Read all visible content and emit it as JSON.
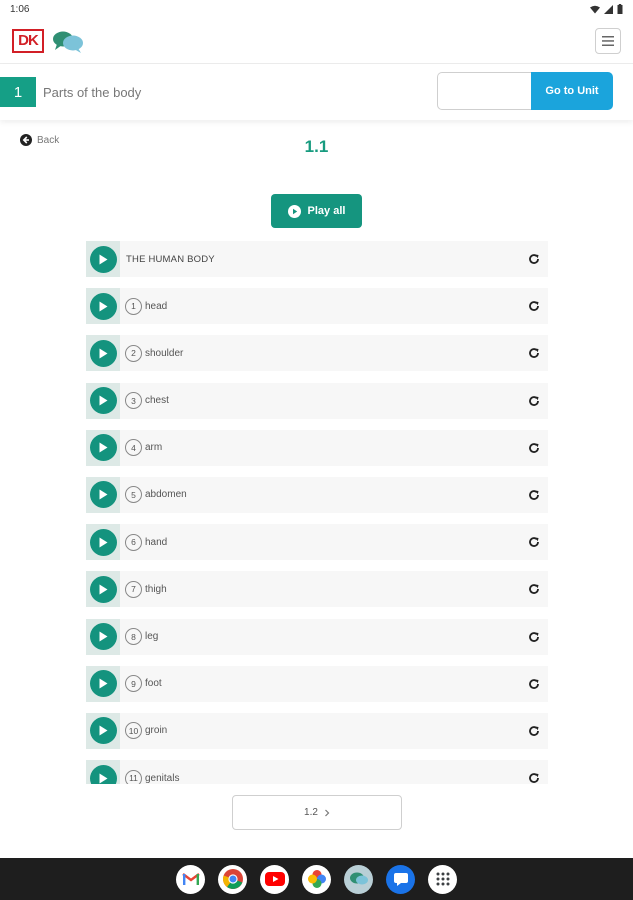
{
  "status_bar": {
    "time": "1:06"
  },
  "header": {
    "brand": "DK",
    "menu_icon": "hamburger-icon"
  },
  "unit_bar": {
    "unit_number": "1",
    "unit_title": "Parts of the body",
    "unit_input_value": "",
    "goto_label": "Go to Unit"
  },
  "nav": {
    "back_label": "Back"
  },
  "section": {
    "title": "1.1"
  },
  "play_all_label": "Play all",
  "tracks": {
    "heading": "THE HUMAN BODY",
    "items": [
      {
        "num": "1",
        "label": "head"
      },
      {
        "num": "2",
        "label": "shoulder"
      },
      {
        "num": "3",
        "label": "chest"
      },
      {
        "num": "4",
        "label": "arm"
      },
      {
        "num": "5",
        "label": "abdomen"
      },
      {
        "num": "6",
        "label": "hand"
      },
      {
        "num": "7",
        "label": "thigh"
      },
      {
        "num": "8",
        "label": "leg"
      },
      {
        "num": "9",
        "label": "foot"
      },
      {
        "num": "10",
        "label": "groin"
      },
      {
        "num": "11",
        "label": "genitals"
      }
    ]
  },
  "pagination": {
    "next_label": "1.2"
  },
  "colors": {
    "accent_green": "#159f86",
    "accent_blue": "#1ba4dc",
    "brand_red": "#d21f26"
  },
  "dock_icons": [
    "gmail-icon",
    "chrome-icon",
    "youtube-icon",
    "photos-icon",
    "app-icon",
    "messages-icon",
    "apps-grid-icon"
  ]
}
